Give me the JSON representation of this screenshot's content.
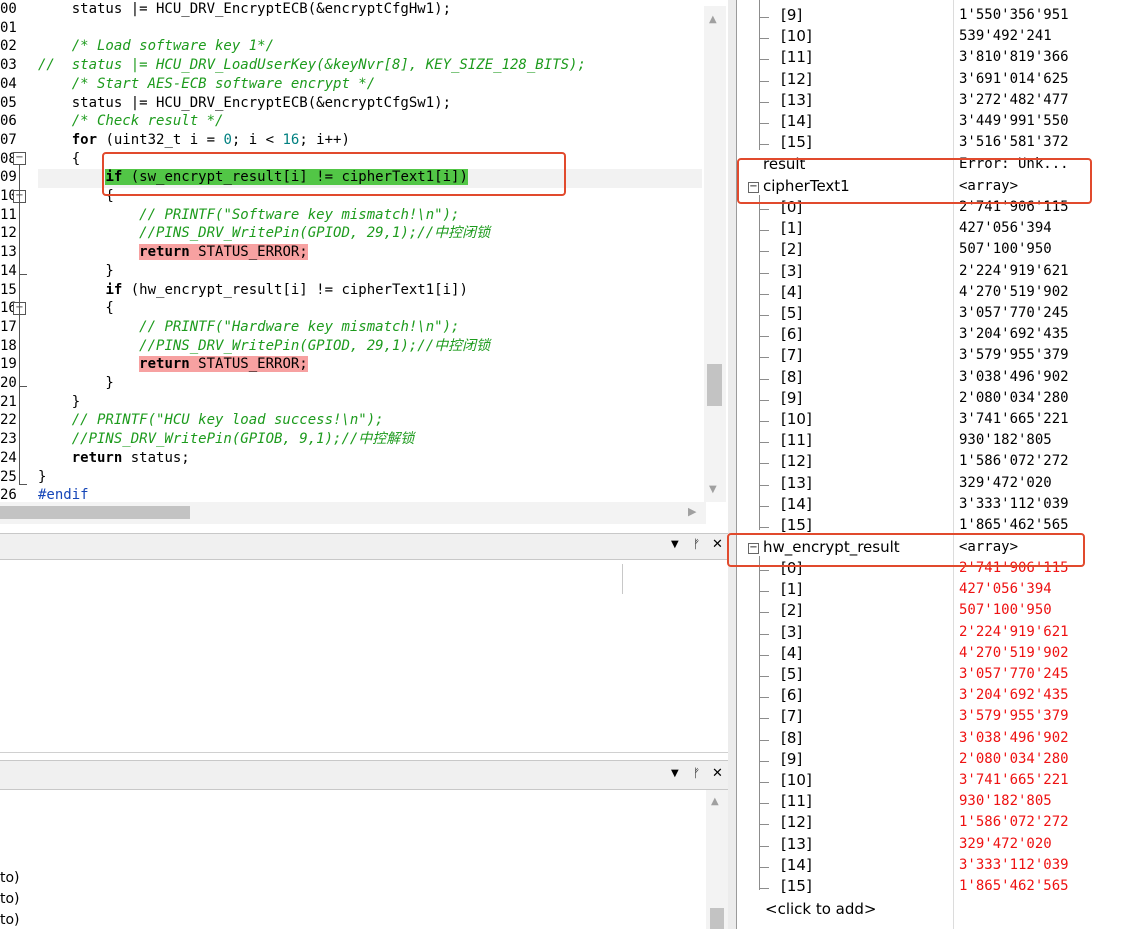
{
  "editor": {
    "line_numbers": [
      "00",
      "01",
      "02",
      "03",
      "04",
      "05",
      "06",
      "07",
      "08",
      "09",
      "10",
      "11",
      "12",
      "13",
      "14",
      "15",
      "16",
      "17",
      "18",
      "19",
      "20",
      "21",
      "22",
      "23",
      "24",
      "25",
      "26"
    ],
    "lines": [
      "    status |= HCU_DRV_EncryptECB(&encryptCfgHw1);",
      "",
      "    /* Load software key 1*/",
      "//  status |= HCU_DRV_LoadUserKey(&keyNvr[8], KEY_SIZE_128_BITS);",
      "    /* Start AES-ECB software encrypt */",
      "    status |= HCU_DRV_EncryptECB(&encryptCfgSw1);",
      "    /* Check result */",
      "    for (uint32_t i = 0; i < 16; i++)",
      "    {",
      "        if (sw_encrypt_result[i] != cipherText1[i])",
      "        {",
      "            // PRINTF(\"Software key mismatch!\\n\");",
      "            //PINS_DRV_WritePin(GPIOD, 29,1);//中控闭锁",
      "            return STATUS_ERROR;",
      "        }",
      "        if (hw_encrypt_result[i] != cipherText1[i])",
      "        {",
      "            // PRINTF(\"Hardware key mismatch!\\n\");",
      "            //PINS_DRV_WritePin(GPIOD, 29,1);//中控闭锁",
      "            return STATUS_ERROR;",
      "        }",
      "    }",
      "    // PRINTF(\"HCU key load success!\\n\");",
      "    //PINS_DRV_WritePin(GPIOB, 9,1);//中控解锁",
      "    return status;",
      "}",
      "#endif"
    ]
  },
  "panels": {
    "pin_glyph": "⊓",
    "close_glyph": "✕",
    "dropdown_glyph": "▼"
  },
  "output": {
    "lines": [
      "to)",
      "to)",
      "to)"
    ]
  },
  "watch": {
    "top_rows": [
      {
        "name": "[9]",
        "value": "1'550'356'951"
      },
      {
        "name": "[10]",
        "value": "539'492'241"
      },
      {
        "name": "[11]",
        "value": "3'810'819'366"
      },
      {
        "name": "[12]",
        "value": "3'691'014'625"
      },
      {
        "name": "[13]",
        "value": "3'272'482'477"
      },
      {
        "name": "[14]",
        "value": "3'449'991'550"
      },
      {
        "name": "[15]",
        "value": "3'516'581'372"
      }
    ],
    "result": {
      "name": "result",
      "value": "Error: Unk..."
    },
    "cipher": {
      "name": "cipherText1",
      "value": "<array>",
      "rows": [
        {
          "name": "[0]",
          "value": "2'741'906'115"
        },
        {
          "name": "[1]",
          "value": "427'056'394"
        },
        {
          "name": "[2]",
          "value": "507'100'950"
        },
        {
          "name": "[3]",
          "value": "2'224'919'621"
        },
        {
          "name": "[4]",
          "value": "4'270'519'902"
        },
        {
          "name": "[5]",
          "value": "3'057'770'245"
        },
        {
          "name": "[6]",
          "value": "3'204'692'435"
        },
        {
          "name": "[7]",
          "value": "3'579'955'379"
        },
        {
          "name": "[8]",
          "value": "3'038'496'902"
        },
        {
          "name": "[9]",
          "value": "2'080'034'280"
        },
        {
          "name": "[10]",
          "value": "3'741'665'221"
        },
        {
          "name": "[11]",
          "value": "930'182'805"
        },
        {
          "name": "[12]",
          "value": "1'586'072'272"
        },
        {
          "name": "[13]",
          "value": "329'472'020"
        },
        {
          "name": "[14]",
          "value": "3'333'112'039"
        },
        {
          "name": "[15]",
          "value": "1'865'462'565"
        }
      ]
    },
    "hw": {
      "name": "hw_encrypt_result",
      "value": "<array>",
      "rows": [
        {
          "name": "[0]",
          "value": "2'741'906'115"
        },
        {
          "name": "[1]",
          "value": "427'056'394"
        },
        {
          "name": "[2]",
          "value": "507'100'950"
        },
        {
          "name": "[3]",
          "value": "2'224'919'621"
        },
        {
          "name": "[4]",
          "value": "4'270'519'902"
        },
        {
          "name": "[5]",
          "value": "3'057'770'245"
        },
        {
          "name": "[6]",
          "value": "3'204'692'435"
        },
        {
          "name": "[7]",
          "value": "3'579'955'379"
        },
        {
          "name": "[8]",
          "value": "3'038'496'902"
        },
        {
          "name": "[9]",
          "value": "2'080'034'280"
        },
        {
          "name": "[10]",
          "value": "3'741'665'221"
        },
        {
          "name": "[11]",
          "value": "930'182'805"
        },
        {
          "name": "[12]",
          "value": "1'586'072'272"
        },
        {
          "name": "[13]",
          "value": "329'472'020"
        },
        {
          "name": "[14]",
          "value": "3'333'112'039"
        },
        {
          "name": "[15]",
          "value": "1'865'462'565"
        }
      ]
    },
    "add_placeholder": "<click to add>"
  },
  "colors": {
    "highlight_box": "#e14a2d",
    "changed_value": "#ee1111",
    "current_statement": "#52c646",
    "return_highlight": "#f7a1a1",
    "comment": "#1d9b1d"
  }
}
